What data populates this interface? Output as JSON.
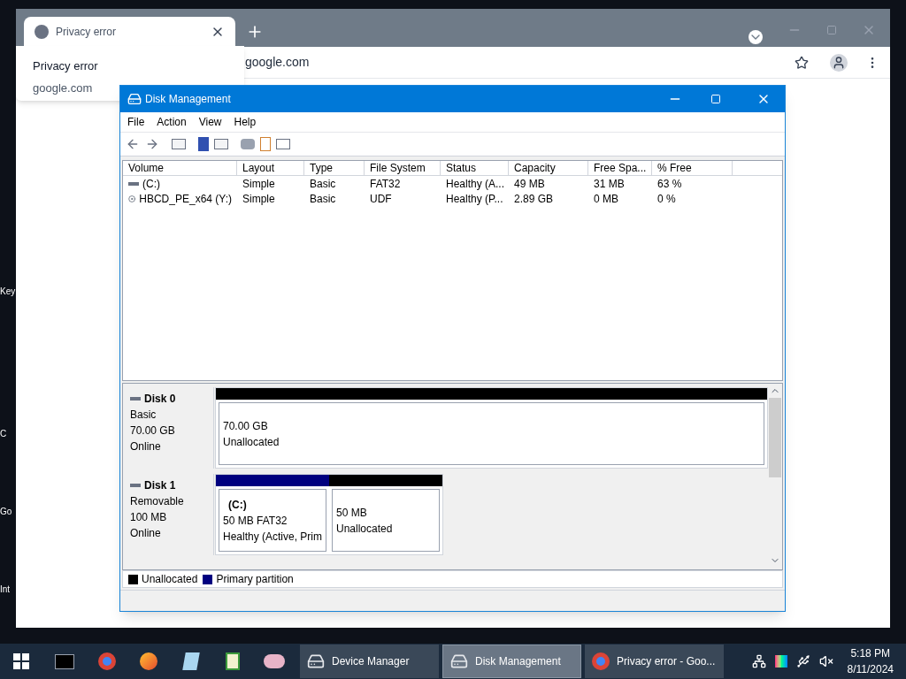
{
  "desktop": {
    "icon_labels": [
      "Key",
      "C",
      "Go",
      "Int"
    ]
  },
  "browser": {
    "tab": {
      "title": "Privacy error"
    },
    "tooltip": {
      "title": "Privacy error",
      "subtitle": "google.com"
    },
    "address": "google.com"
  },
  "disk_management": {
    "title": "Disk Management",
    "menu": [
      "File",
      "Action",
      "View",
      "Help"
    ],
    "columns": [
      "Volume",
      "Layout",
      "Type",
      "File System",
      "Status",
      "Capacity",
      "Free Spa...",
      "% Free"
    ],
    "rows": [
      {
        "kind": "disk",
        "cells": [
          "(C:)",
          "Simple",
          "Basic",
          "FAT32",
          "Healthy (A...",
          "49 MB",
          "31 MB",
          "63 %"
        ]
      },
      {
        "kind": "cd",
        "cells": [
          "HBCD_PE_x64 (Y:)",
          "Simple",
          "Basic",
          "UDF",
          "Healthy (P...",
          "2.89 GB",
          "0 MB",
          "0 %"
        ]
      }
    ],
    "disks": [
      {
        "name": "Disk 0",
        "type": "Basic",
        "size": "70.00 GB",
        "status": "Online",
        "partitions": [
          {
            "kind": "unallocated",
            "lines": [
              "70.00 GB",
              "Unallocated"
            ]
          }
        ]
      },
      {
        "name": "Disk 1",
        "type": "Removable",
        "size": "100 MB",
        "status": "Online",
        "partitions": [
          {
            "kind": "primary",
            "label": "(C:)",
            "lines": [
              "50 MB FAT32",
              "Healthy (Active, Prim"
            ]
          },
          {
            "kind": "unallocated",
            "lines": [
              "50 MB",
              "Unallocated"
            ]
          }
        ]
      }
    ],
    "legend": [
      {
        "label": "Unallocated",
        "color": "#000000"
      },
      {
        "label": "Primary partition",
        "color": "#00007f"
      }
    ]
  },
  "taskbar": {
    "windows": [
      {
        "label": "Device Manager",
        "kind": "device",
        "selected": false
      },
      {
        "label": "Disk Management",
        "kind": "disk",
        "selected": true
      },
      {
        "label": "Privacy error - Goo...",
        "kind": "browser",
        "selected": false
      }
    ],
    "time": "5:18 PM",
    "date": "8/11/2024"
  }
}
